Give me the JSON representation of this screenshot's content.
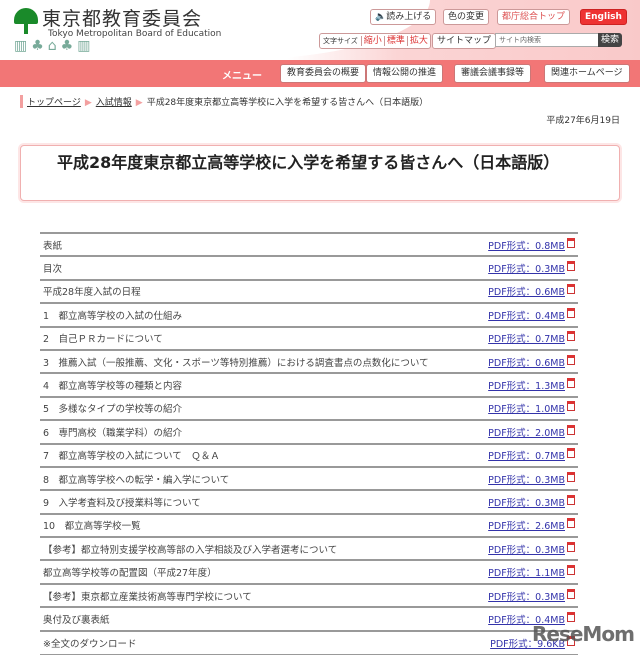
{
  "header": {
    "org_name": "東京都教育委員会",
    "org_name_en": "Tokyo Metropolitan Board of Education",
    "buttons": {
      "read_aloud": "読み上げる",
      "color_change": "色の変更",
      "metro_top": "都庁総合トップ",
      "english": "English"
    },
    "font_size": {
      "label": "文字サイズ",
      "small": "縮小",
      "standard": "標準",
      "large": "拡大"
    },
    "sitemap": "サイトマップ",
    "search_placeholder": "サイト内検索",
    "search_button": "検索"
  },
  "menu": {
    "label": "メニュー",
    "items": [
      "教育委員会の概要",
      "情報公開の推進",
      "審議会議事録等",
      "関連ホームページ"
    ]
  },
  "breadcrumb": [
    "トップページ",
    "入試情報",
    "平成28年度東京都立高等学校に入学を希望する皆さんへ（日本語版）"
  ],
  "date": "平成27年6月19日",
  "title": "平成28年度東京都立高等学校に入学を希望する皆さんへ（日本語版）",
  "documents": [
    {
      "name": "表紙",
      "link": "PDF形式：0.8MB"
    },
    {
      "name": "目次",
      "link": "PDF形式：0.3MB"
    },
    {
      "name": "平成28年度入試の日程",
      "link": "PDF形式：0.6MB"
    },
    {
      "name": "1　都立高等学校の入試の仕組み",
      "link": "PDF形式：0.4MB"
    },
    {
      "name": "2　自己ＰＲカードについて",
      "link": "PDF形式：0.7MB"
    },
    {
      "name": "3　推薦入試（一般推薦、文化・スポーツ等特別推薦）における調査書点の点数化について",
      "link": "PDF形式：0.6MB"
    },
    {
      "name": "4　都立高等学校等の種類と内容",
      "link": "PDF形式：1.3MB"
    },
    {
      "name": "5　多様なタイプの学校等の紹介",
      "link": "PDF形式：1.0MB"
    },
    {
      "name": "6　専門高校（職業学科）の紹介",
      "link": "PDF形式：2.0MB"
    },
    {
      "name": "7　都立高等学校の入試について　Ｑ＆Ａ",
      "link": "PDF形式：0.7MB"
    },
    {
      "name": "8　都立高等学校への転学・編入学について",
      "link": "PDF形式：0.3MB"
    },
    {
      "name": "9　入学考査料及び授業料等について",
      "link": "PDF形式：0.3MB"
    },
    {
      "name": "10　都立高等学校一覧",
      "link": "PDF形式：2.6MB"
    },
    {
      "name": "【参考】都立特別支援学校高等部の入学相談及び入学者選考について",
      "link": "PDF形式：0.3MB"
    },
    {
      "name": "都立高等学校等の配置図（平成27年度）",
      "link": "PDF形式：1.1MB"
    },
    {
      "name": "【参考】東京都立産業技術高等専門学校について",
      "link": "PDF形式：0.3MB"
    },
    {
      "name": "奥付及び裏表紙",
      "link": "PDF形式：0.4MB"
    },
    {
      "name": "※全文のダウンロード",
      "link": "PDF形式：9.6KB"
    }
  ],
  "watermark": "ReseMom"
}
